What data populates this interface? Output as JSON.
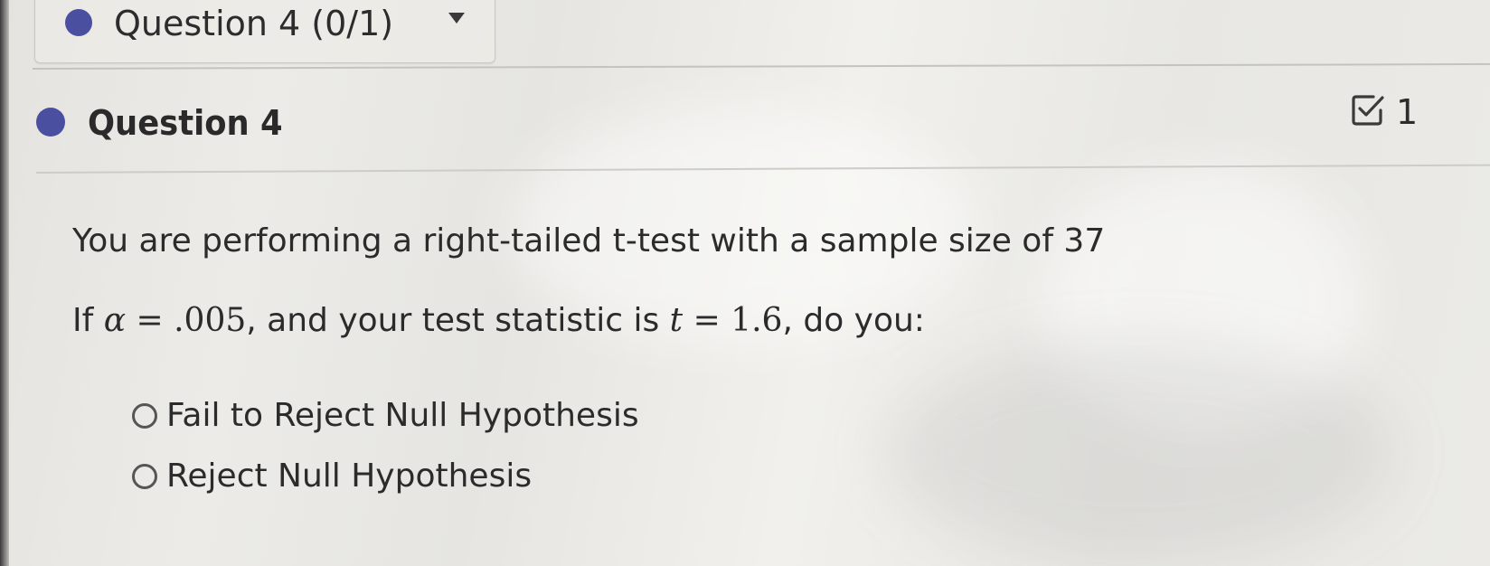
{
  "question_selector": {
    "label": "Question 4 (0/1)",
    "icon": "chevron-down-icon"
  },
  "question": {
    "title": "Question 4",
    "points": "1",
    "text": "You are performing a right-tailed t-test with a sample size of 37",
    "math": {
      "prefix": "If ",
      "alpha_symbol": "α",
      "equals1": " = ",
      "alpha_value": ".005",
      "mid": ", and your test statistic is ",
      "t_symbol": "t",
      "equals2": " = ",
      "t_value": "1.6",
      "suffix": ", do you:"
    },
    "options": [
      {
        "label": "Fail to Reject Null Hypothesis",
        "selected": false
      },
      {
        "label": "Reject Null Hypothesis",
        "selected": false
      }
    ]
  },
  "colors": {
    "status_dot": "#4a4fa0",
    "background": "#e9e8e4",
    "text": "#2b2b2b"
  }
}
